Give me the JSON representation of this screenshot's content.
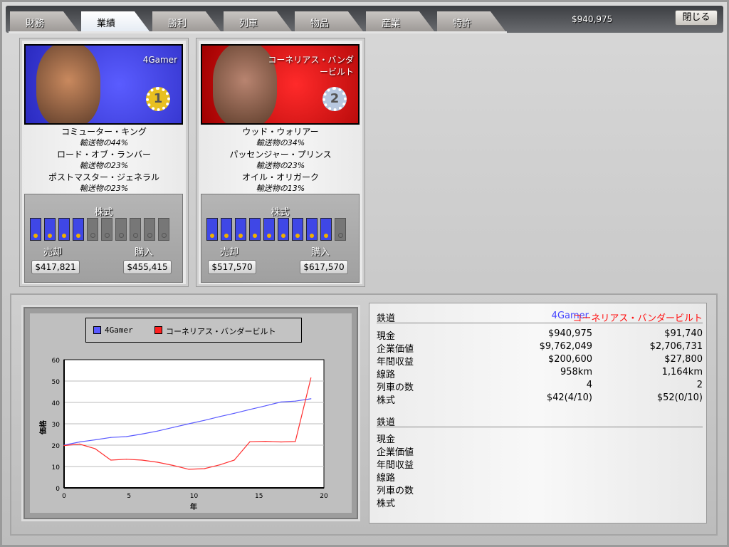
{
  "tabs": [
    "財務",
    "業績",
    "勝利",
    "列車",
    "物品",
    "産業",
    "特許"
  ],
  "active_tab": "業績",
  "cash": "$940,975",
  "close_label": "閉じる",
  "players": [
    {
      "name": "4Gamer",
      "rank": "1",
      "color": "#4448f0",
      "titles": [
        {
          "title": "コミューター・キング",
          "share": "輸送物の44%"
        },
        {
          "title": "ロード・オブ・ランバー",
          "share": "輸送物の23%"
        },
        {
          "title": "ポストマスター・ジェネラル",
          "share": "輸送物の23%"
        }
      ],
      "stock_label": "株式",
      "shares_owned": 4,
      "shares_total": 10,
      "sell_label": "売却",
      "buy_label": "購入",
      "sell_price": "$417,821",
      "buy_price": "$455,415"
    },
    {
      "name": "コーネリアス・バンダービルト",
      "rank": "2",
      "color": "#e8141a",
      "titles": [
        {
          "title": "ウッド・ウォリアー",
          "share": "輸送物の34%"
        },
        {
          "title": "パッセンジャー・プリンス",
          "share": "輸送物の23%"
        },
        {
          "title": "オイル・オリガーク",
          "share": "輸送物の13%"
        }
      ],
      "stock_label": "株式",
      "shares_owned": 9,
      "shares_total": 10,
      "sell_label": "売却",
      "buy_label": "購入",
      "sell_price": "$517,570",
      "buy_price": "$617,570"
    }
  ],
  "chart_data": {
    "type": "line",
    "title": "",
    "xlabel": "年",
    "ylabel": "価格",
    "xlim": [
      0,
      20
    ],
    "ylim": [
      0,
      60
    ],
    "xticks": [
      "0",
      "5",
      "10",
      "15",
      "20"
    ],
    "yticks": [
      "0",
      "10",
      "20",
      "30",
      "40",
      "50",
      "60"
    ],
    "grid": true,
    "legend": "top",
    "x": [
      0,
      1.2,
      2.4,
      3.6,
      4.8,
      6,
      7.2,
      8.4,
      9.6,
      10.8,
      12,
      13.1,
      14.3,
      15.5,
      16.7,
      17.8,
      19
    ],
    "series": [
      {
        "name": "4Gamer",
        "color": "#5a5aff",
        "values": [
          20,
          21.5,
          22.5,
          23.6,
          24,
          25.2,
          26.6,
          28.3,
          30,
          31.6,
          33.4,
          34.9,
          36.7,
          38.4,
          40.2,
          40.6,
          41.7
        ]
      },
      {
        "name": "コーネリアス・バンダービルト",
        "color": "#ff3030",
        "values": [
          19.8,
          20.5,
          18.3,
          13,
          13.4,
          13,
          12,
          10.5,
          8.7,
          9,
          10.8,
          13,
          21.6,
          21.8,
          21.5,
          21.7,
          51.5
        ]
      }
    ]
  },
  "stats": {
    "header": "鉄道",
    "col_a": "4Gamer",
    "col_b": "コーネリアス・バンダービルト",
    "rows": [
      [
        "現金",
        "$940,975",
        "$91,740"
      ],
      [
        "企業価値",
        "$9,762,049",
        "$2,706,731"
      ],
      [
        "年間収益",
        "$200,600",
        "$27,800"
      ],
      [
        "線路",
        "958km",
        "1,164km"
      ],
      [
        "列車の数",
        "4",
        "2"
      ],
      [
        "株式",
        "$42(4/10)",
        "$52(0/10)"
      ]
    ],
    "header2": "鉄道",
    "rows2": [
      "現金",
      "企業価値",
      "年間収益",
      "線路",
      "列車の数",
      "株式"
    ]
  }
}
